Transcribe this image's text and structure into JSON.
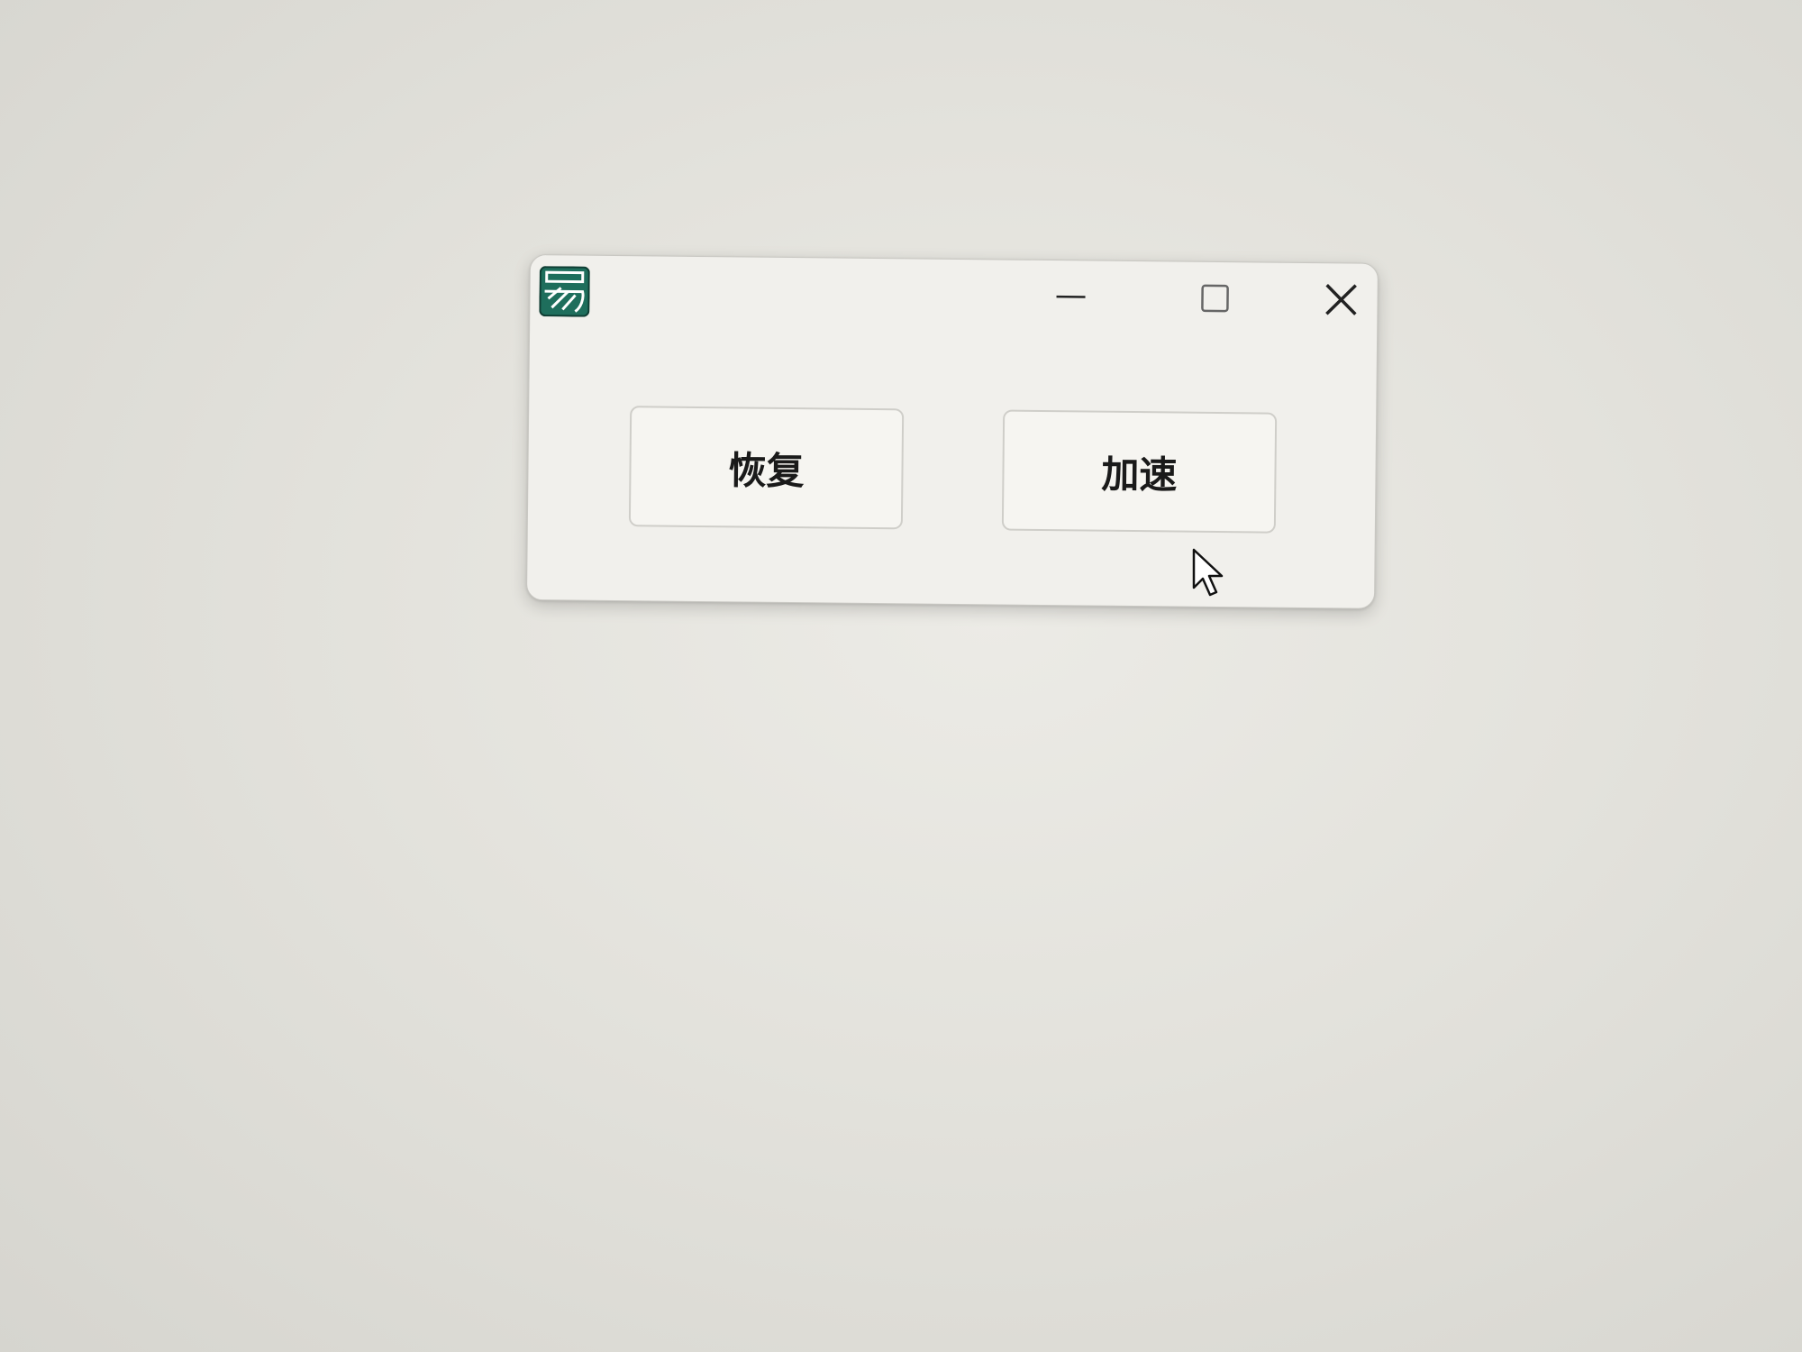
{
  "window": {
    "title": "",
    "controls": {
      "minimize": "minimize-icon",
      "maximize": "maximize-icon",
      "close": "close-icon"
    }
  },
  "app_icon": {
    "name": "app-logo-icon",
    "colors": {
      "background": "#1e6e5c",
      "stripes": "#ffffff",
      "border": "#0f3d33"
    }
  },
  "buttons": {
    "restore_label": "恢复",
    "speedup_label": "加速"
  },
  "colors": {
    "window_bg": "#f1f0ec",
    "button_bg": "#f6f5f1",
    "button_border": "#cfcec9",
    "text": "#1a1a1a"
  }
}
